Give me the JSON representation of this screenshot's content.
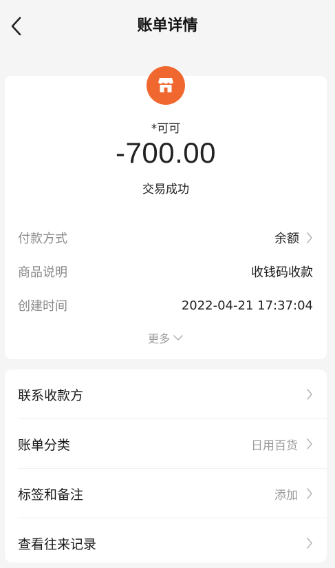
{
  "header": {
    "title": "账单详情"
  },
  "transaction": {
    "counterparty": "*可可",
    "amount": "-700.00",
    "status": "交易成功"
  },
  "details": [
    {
      "label": "付款方式",
      "value": "余额",
      "has_chevron": true
    },
    {
      "label": "商品说明",
      "value": "收钱码收款",
      "has_chevron": false
    },
    {
      "label": "创建时间",
      "value": "2022-04-21 17:37:04",
      "has_chevron": false
    }
  ],
  "more_label": "更多",
  "actions": [
    {
      "label": "联系收款方",
      "value": ""
    },
    {
      "label": "账单分类",
      "value": "日用百货"
    },
    {
      "label": "标签和备注",
      "value": "添加"
    },
    {
      "label": "查看往来记录",
      "value": ""
    }
  ],
  "colors": {
    "accent": "#f0682f",
    "background": "#f5f5f5",
    "muted_text": "#8a8a8a"
  },
  "icons": {
    "back": "chevron-left-icon",
    "merchant": "shop-icon",
    "row_chevron": "chevron-right-icon",
    "more_chevron": "chevron-down-icon"
  }
}
